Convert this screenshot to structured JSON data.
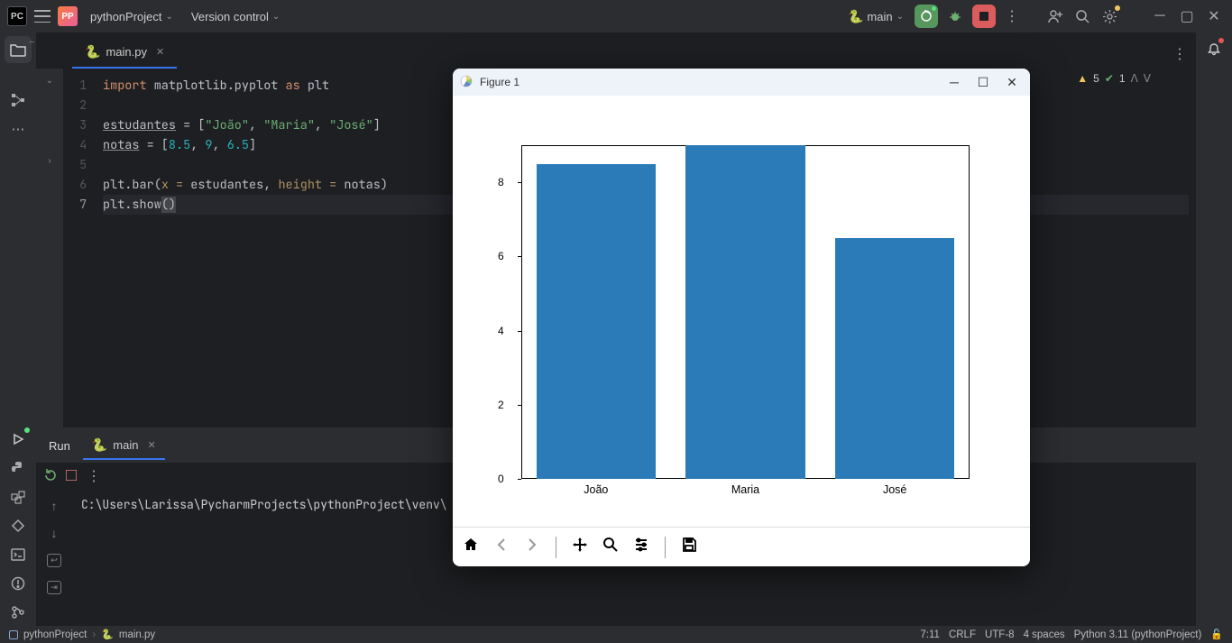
{
  "topbar": {
    "project": "pythonProject",
    "version_control": "Version control",
    "run_config_name": "main",
    "kebab": "⋮"
  },
  "file_tabs": {
    "tab1_name": "main.py"
  },
  "editor_hints": {
    "warn_count": "5",
    "ok_count": "1"
  },
  "code_lines": {
    "l1_import": "import",
    "l1_mod": " matplotlib.pyplot ",
    "l1_as": "as",
    "l1_alias": " plt",
    "l3_var": "estudantes",
    "l3_eq": " = [",
    "l3_s1": "\"João\"",
    "l3_c1": ", ",
    "l3_s2": "\"Maria\"",
    "l3_c2": ", ",
    "l3_s3": "\"José\"",
    "l3_end": "]",
    "l4_var": "notas",
    "l4_eq": " = [",
    "l4_n1": "8.5",
    "l4_c1": ", ",
    "l4_n2": "9",
    "l4_c2": ", ",
    "l4_n3": "6.5",
    "l4_end": "]",
    "l6_a": "plt.bar(",
    "l6_x": "x",
    "l6_eq1": " = ",
    "l6_b": "estudantes, ",
    "l6_h": "height",
    "l6_eq2": " = ",
    "l6_c": "notas)",
    "l7_a": "plt.show",
    "l7_b": "()"
  },
  "gutter": {
    "n1": "1",
    "n2": "2",
    "n3": "3",
    "n4": "4",
    "n5": "5",
    "n6": "6",
    "n7": "7"
  },
  "run_panel": {
    "title": "Run",
    "tab_name": "main",
    "output_line": "C:\\Users\\Larissa\\PycharmProjects\\pythonProject\\venv\\"
  },
  "mpl": {
    "title": "Figure 1"
  },
  "statusbar": {
    "crumb_project": "pythonProject",
    "crumb_file": "main.py",
    "pos": "7:11",
    "linesep": "CRLF",
    "encoding": "UTF-8",
    "indent": "4 spaces",
    "interpreter": "Python 3.11 (pythonProject)"
  },
  "chart_data": {
    "type": "bar",
    "categories": [
      "João",
      "Maria",
      "José"
    ],
    "values": [
      8.5,
      9,
      6.5
    ],
    "ylim": [
      0,
      9
    ],
    "yticks": [
      0,
      2,
      4,
      6,
      8
    ],
    "bar_color": "#2a7bb7"
  }
}
